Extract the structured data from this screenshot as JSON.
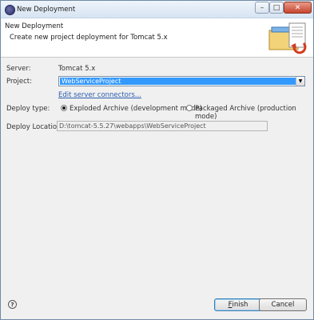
{
  "window": {
    "title": "New Deployment"
  },
  "header": {
    "title": "New Deployment",
    "description": "Create new project deployment for Tomcat  5.x"
  },
  "form": {
    "server_label": "Server:",
    "server_value": "Tomcat  5.x",
    "project_label": "Project:",
    "project_value": "WebServiceProject",
    "edit_connectors_link": "Edit server connectors...",
    "deploy_type_label": "Deploy type:",
    "deploy_options": [
      {
        "label": "Exploded Archive (development mode)",
        "selected": true
      },
      {
        "label": "Packaged Archive (production mode)",
        "selected": false
      }
    ],
    "deploy_location_label": "Deploy Location:",
    "deploy_location_value": "D:\\tomcat-5.5.27\\webapps\\WebServiceProject"
  },
  "footer": {
    "finish_label": "Finish",
    "finish_mnemonic": "F",
    "finish_rest": "inish",
    "cancel_label": "Cancel"
  },
  "icons": {
    "app": "eclipse-icon",
    "help": "help-icon",
    "wizard": "deployment-wizard-icon"
  }
}
